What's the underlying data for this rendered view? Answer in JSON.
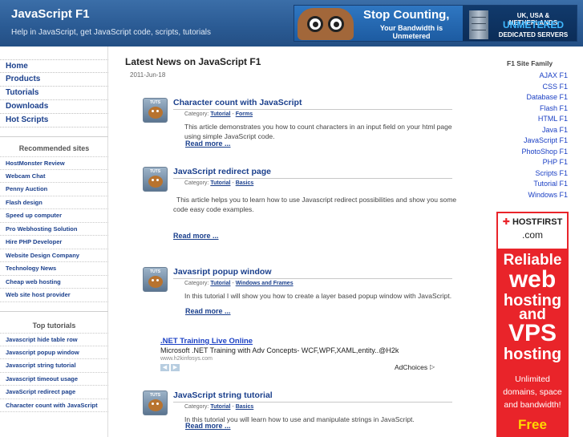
{
  "header": {
    "title": "JavaScript F1",
    "tagline": "Help in JavaScript, get JavaScript code, scripts, tutorials"
  },
  "banner": {
    "headline": "Stop Counting,",
    "sub1": "Your Bandwidth is",
    "sub2": "Unmetered",
    "right1": "UK, USA & NETHERLANDS",
    "right2": "UNMETERED",
    "right3": "DEDICATED SERVERS"
  },
  "nav": [
    "Home",
    "Products",
    "Tutorials",
    "Downloads",
    "Hot Scripts"
  ],
  "recommended": {
    "heading": "Recommended sites",
    "items": [
      "HostMonster Review",
      "Webcam Chat",
      "Penny Auction",
      "Flash design",
      "Speed up computer",
      "Pro Webhosting Solution",
      "Hire PHP Developer",
      "Website Design Company",
      "Technology News",
      "Cheap web hosting",
      "Web site host provider"
    ]
  },
  "top_tutorials": {
    "heading": "Top tutorials",
    "items": [
      "Javascript hide table row",
      "Javascript popup window",
      "Javascript string tutorial",
      "Javascript timeout usage",
      "JavaScript redirect page",
      "Character count with JavaScript"
    ]
  },
  "main": {
    "title": "Latest News on JavaScript F1",
    "date": "2011-Jun-18",
    "thumb_label": "TUTS",
    "category_label": "Category:",
    "articles": [
      {
        "title": "Character count with JavaScript",
        "cat1": "Tutorial",
        "cat2": "Forms",
        "desc": "This article demonstrates you how to count characters in an input field on your html page using simple JavaScript code.",
        "more": "Read more ..."
      },
      {
        "title": "JavaScript redirect page",
        "cat1": "Tutorial",
        "cat2": "Basics",
        "desc": "This article helps you to learn how to use Javascript redirect possibilities and show you some code easy code examples.",
        "more": "Read more ..."
      },
      {
        "title": "Javasript popup window",
        "cat1": "Tutorial",
        "cat2": "Windows and Frames",
        "desc": "In this tutorial I will show you how to create a layer based popup window with JavaScript.",
        "more": "Read more ..."
      },
      {
        "title": "JavaScript string tutorial",
        "cat1": "Tutorial",
        "cat2": "Basics",
        "desc": "In this tutorial you will learn how to use and manipulate strings in JavaScript.",
        "more": "Read more ..."
      }
    ]
  },
  "ad": {
    "title": ".NET Training Live Online",
    "text": "Microsoft .NET Training with Adv Concepts- WCF,WPF,XAML,entity..@H2k",
    "url": "www.h2kinfosys.com",
    "choices": "AdChoices"
  },
  "family": {
    "title": "F1 Site Family",
    "items": [
      "AJAX F1",
      "CSS F1",
      "Database F1",
      "Flash F1",
      "HTML F1",
      "Java F1",
      "JavaScript F1",
      "PhotoShop F1",
      "PHP F1",
      "Scripts F1",
      "Tutorial F1",
      "Windows F1"
    ]
  },
  "hostfirst": {
    "logo1": "HOSTFIRST",
    "logo2": ".com",
    "l1": "Reliable",
    "l2": "web",
    "l3": "hosting",
    "l4": "and",
    "l5": "VPS",
    "l6": "hosting",
    "s1": "Unlimited",
    "s2": "domains, space",
    "s3": "and bandwidth!",
    "free": "Free"
  },
  "colors": {
    "header_blue": "#2a5a93",
    "link_blue": "#1a3f8c",
    "ad_red": "#e9242a"
  }
}
